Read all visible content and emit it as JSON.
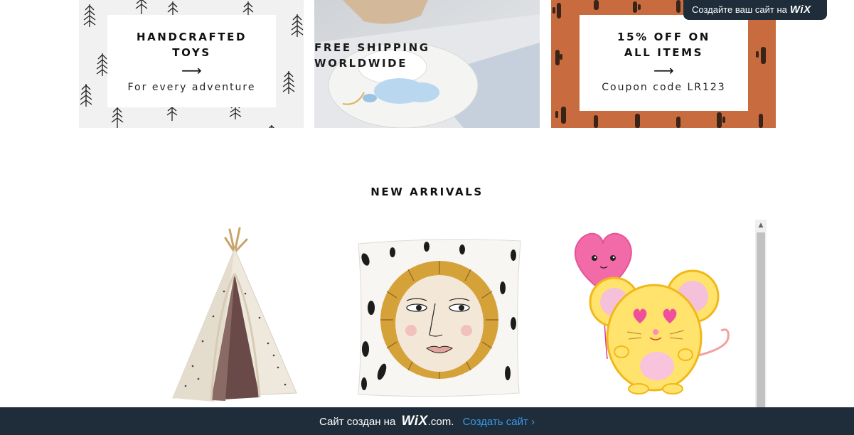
{
  "promos": [
    {
      "title": "HANDCRAFTED\nTOYS",
      "arrow": "⟶",
      "subtitle": "For every adventure"
    },
    {
      "title": "FREE SHIPPING\nWORLDWIDE"
    },
    {
      "title": "15% OFF ON\nALL ITEMS",
      "arrow": "⟶",
      "subtitle": "Coupon code LR123"
    }
  ],
  "wix_badge": {
    "text": "Создайте ваш сайт на",
    "logo": "WiX"
  },
  "section": {
    "title": "NEW ARRIVALS"
  },
  "products": [
    {
      "icon": "teepee-tent-icon"
    },
    {
      "icon": "lion-pillow-icon"
    },
    {
      "icon": "mouse-balloon-icon"
    }
  ],
  "wix_bar": {
    "prefix": "Сайт создан на",
    "logo": "WiX",
    "dotcom": ".com.",
    "link": "Создать сайт ›"
  },
  "colors": {
    "dark_bar": "#1f2d3a",
    "link_blue": "#3899ec",
    "cactus_bg": "#c86b3e"
  }
}
